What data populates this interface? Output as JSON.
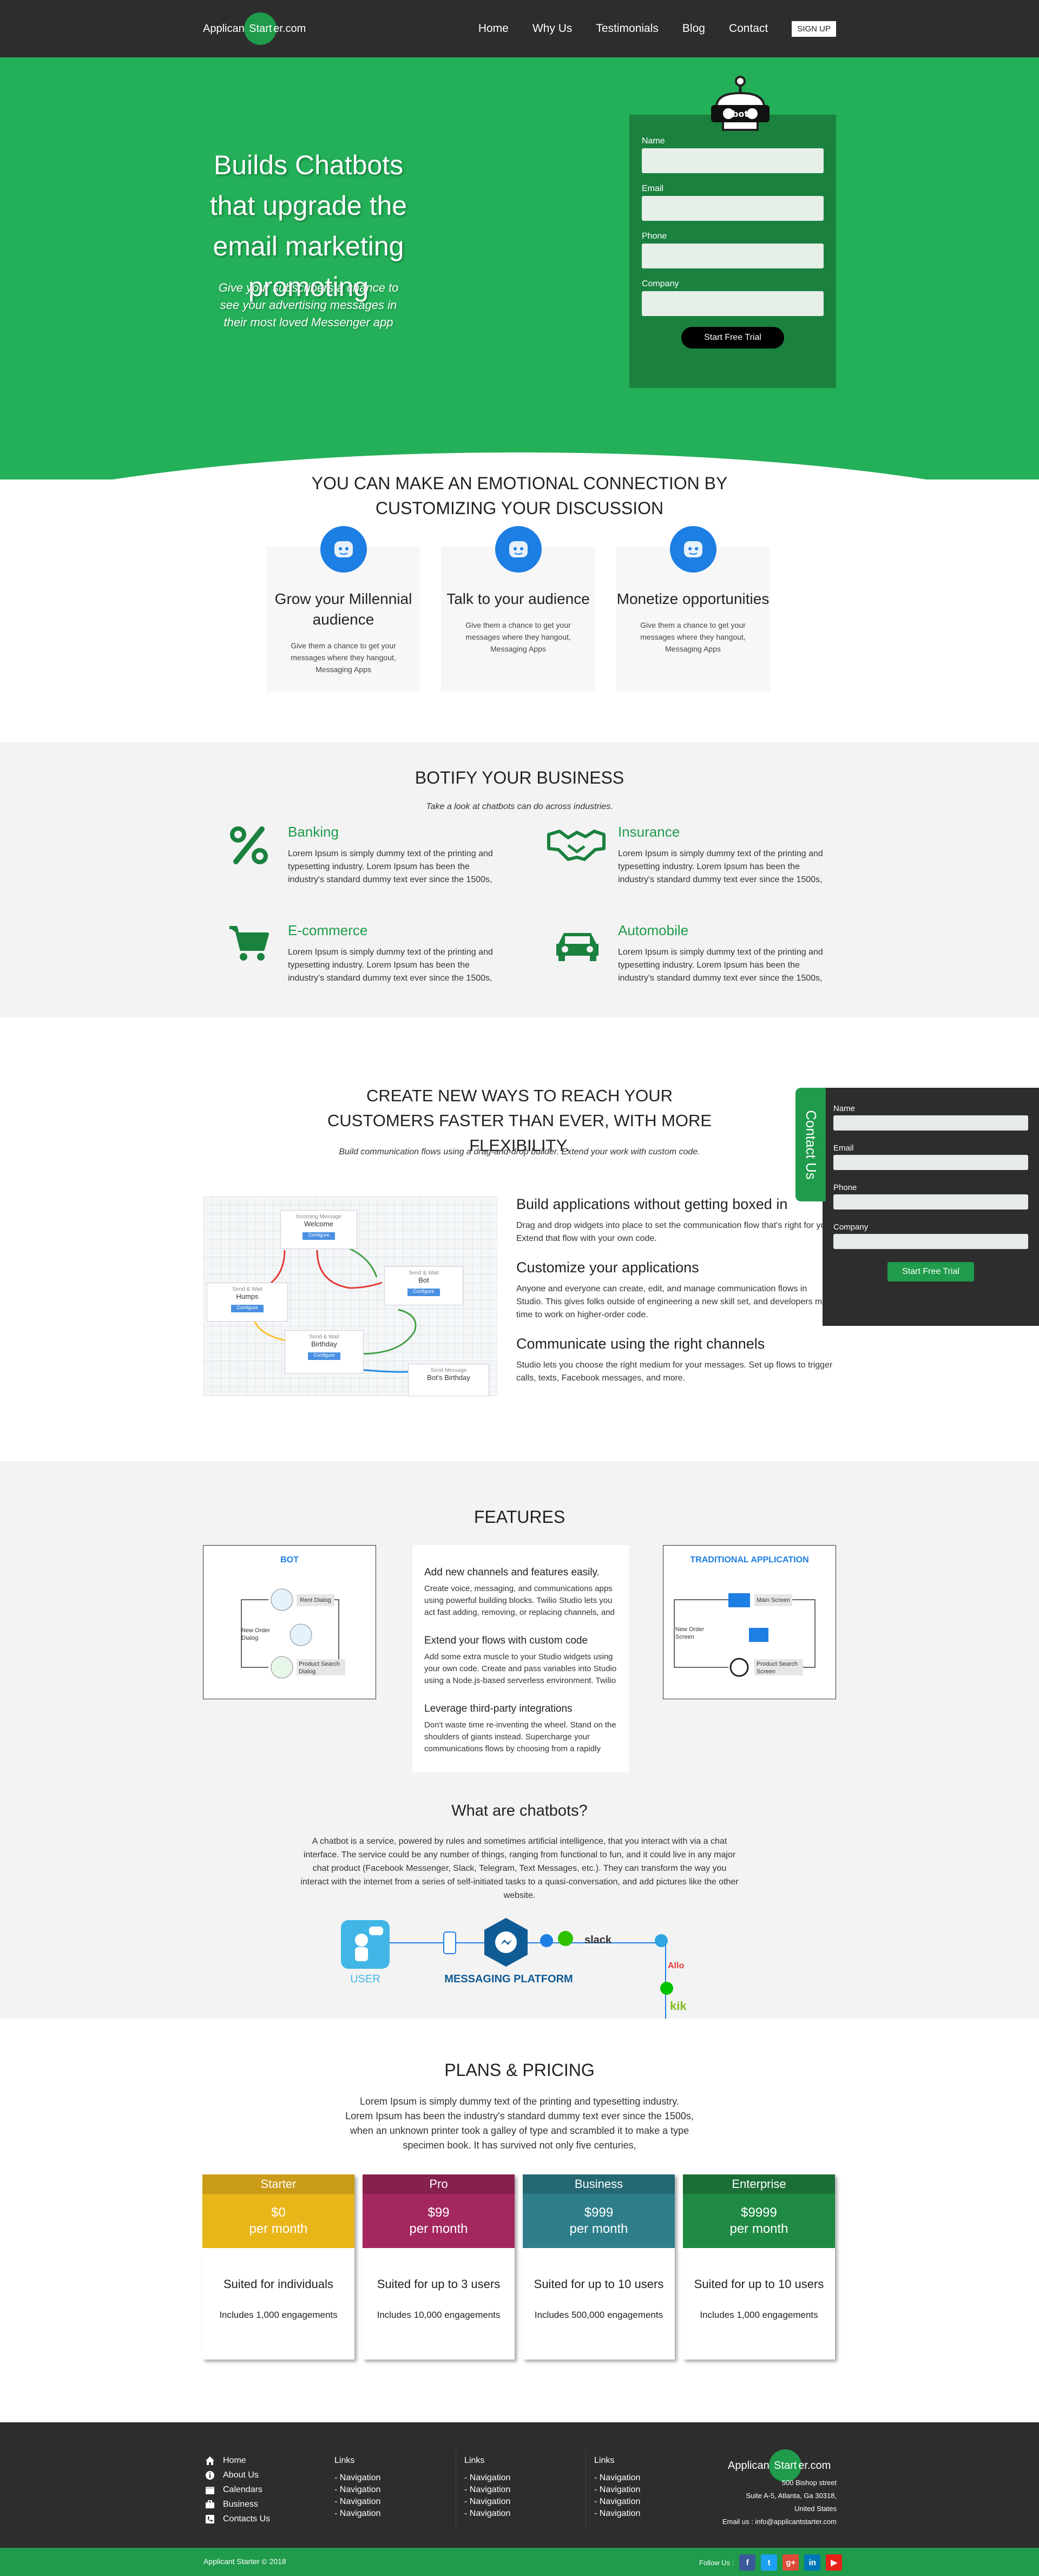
{
  "nav": {
    "logo_left": "Applicant",
    "logo_mid": "Start",
    "logo_right": "er.com",
    "items": [
      "Home",
      "Why Us",
      "Testimonials",
      "Blog",
      "Contact"
    ],
    "signup": "SIGN UP"
  },
  "hero": {
    "title": "Builds Chatbots that upgrade the email marketing promoting",
    "subtitle": "Give your subscribers a chance to see your advertising messages in their most loved Messenger app",
    "robot_text": "bot",
    "form": {
      "fields": [
        "Name",
        "Email",
        "Phone",
        "Company"
      ],
      "button": "Start Free Trial"
    }
  },
  "connect": {
    "title": "YOU CAN MAKE AN EMOTIONAL CONNECTION BY CUSTOMIZING YOUR DISCUSSION",
    "cards": [
      {
        "title": "Grow your Millennial audience",
        "text": "Give them a chance to get your messages where they hangout, Messaging Apps"
      },
      {
        "title": "Talk to your audience",
        "text": "Give them a chance to get your messages where they hangout, Messaging Apps"
      },
      {
        "title": "Monetize opportunities",
        "text": "Give them a chance to get your messages where they hangout, Messaging Apps"
      }
    ]
  },
  "botify": {
    "title": "BOTIFY YOUR BUSINESS",
    "subtitle": "Take a look at chatbots can do across industries.",
    "industries": [
      {
        "name": "Banking",
        "icon": "percent-icon",
        "text": "Lorem Ipsum is simply dummy text of the printing and typesetting industry. Lorem Ipsum has been the industry's standard dummy text ever since the 1500s,"
      },
      {
        "name": "Insurance",
        "icon": "handshake-icon",
        "text": "Lorem Ipsum is simply dummy text of the printing and typesetting industry. Lorem Ipsum has been the industry's standard dummy text ever since the 1500s,"
      },
      {
        "name": "E-commerce",
        "icon": "cart-icon",
        "text": "Lorem Ipsum is simply dummy text of the printing and typesetting industry. Lorem Ipsum has been the industry's standard dummy text ever since the 1500s,"
      },
      {
        "name": "Automobile",
        "icon": "car-icon",
        "text": "Lorem Ipsum is simply dummy text of the printing and typesetting industry. Lorem Ipsum has been the industry's standard dummy text ever since the 1500s,"
      }
    ]
  },
  "create": {
    "title": "CREATE NEW WAYS TO REACH YOUR CUSTOMERS FASTER THAN EVER, WITH MORE FLEXIBILITY.",
    "subtitle": "Build communication flows using a drag-and-drop builder. Extend your work with custom code.",
    "flow_nodes": [
      {
        "tag": "Incoming Message",
        "name": "Welcome"
      },
      {
        "tag": "Send & Wait",
        "name": "Humps"
      },
      {
        "tag": "Send & Wait",
        "name": "Bot"
      },
      {
        "tag": "Send & Wait",
        "name": "Birthday"
      },
      {
        "tag": "Send Message",
        "name": "Bot's Birthday"
      }
    ],
    "flow_button": "Configure",
    "features": [
      {
        "title": "Build applications without getting boxed in",
        "text": "Drag and drop widgets into place to set the communication flow that's right for you. Extend that flow with your own code."
      },
      {
        "title": "Customize your applications",
        "text": "Anyone and everyone can create, edit, and manage communication flows in Studio. This gives folks outside of engineering a new skill set, and developers more time to work on higher-order code."
      },
      {
        "title": "Communicate using the right channels",
        "text": "Studio lets you choose the right medium for your messages. Set up flows to trigger calls, texts, Facebook messages, and more."
      }
    ],
    "contact": {
      "tab": "Contact Us",
      "fields": [
        "Name",
        "Email",
        "Phone",
        "Company"
      ],
      "button": "Start Free Trial"
    }
  },
  "features": {
    "title": "FEATURES",
    "bot_box": {
      "label": "BOT",
      "items": [
        "Rent Dialog",
        "New Order Dialog",
        "Product Search Dialog"
      ]
    },
    "trad_box": {
      "label": "TRADITIONAL APPLICATION",
      "items": [
        "Main Screen",
        "New Order Screen",
        "Product Search Screen"
      ]
    },
    "middle": [
      {
        "title": "Add new channels and features easily.",
        "text": "Create voice, messaging, and communications apps using powerful building blocks. Twilio Studio lets you act fast adding, removing, or replacing channels, and"
      },
      {
        "title": "Extend your flows with custom code",
        "text": "Add some extra muscle to your Studio widgets using your own code. Create and pass variables into Studio using a Node.js-based serverless environment. Twilio"
      },
      {
        "title": "Leverage third-party integrations",
        "text": "Don't waste time re-inventing the wheel. Stand on the shoulders of giants instead. Supercharge your communications flows by choosing from a rapidly"
      }
    ],
    "what_title": "What are chatbots?",
    "what_text": "A chatbot is a service, powered by rules and sometimes artificial intelligence, that you interact with via a chat interface. The service could be any number of things, ranging from functional to fun, and it could live in any major chat product (Facebook Messenger, Slack, Telegram, Text Messages, etc.). They can transform the way you interact with the internet from a series of self-initiated tasks to a quasi-conversation, and add pictures like the other website.",
    "platform": {
      "user": "USER",
      "messaging": "MESSAGING PLATFORM",
      "slack": "slack",
      "allo": "Allo",
      "kik": "kik"
    }
  },
  "pricing": {
    "title": "PLANS & PRICING",
    "subtitle": "Lorem Ipsum is simply dummy text of the printing and typesetting industry. Lorem Ipsum has been the industry's standard dummy text ever since the 1500s, when an unknown printer took a galley of type and scrambled it to make a type specimen book. It has survived not only five centuries,",
    "plans": [
      {
        "name": "Starter",
        "price": "$0",
        "period": "per month",
        "suited": "Suited for individuals",
        "includes": "Includes 1,000 engagements",
        "head": "#c99b17",
        "body": "#e9b619"
      },
      {
        "name": "Pro",
        "price": "$99",
        "period": "per month",
        "suited": "Suited for up to 3 users",
        "includes": "Includes 10,000 engagements",
        "head": "#86204d",
        "body": "#a4285f"
      },
      {
        "name": "Business",
        "price": "$999",
        "period": "per month",
        "suited": "Suited for up to 10 users",
        "includes": "Includes 500,000 engagements",
        "head": "#246872",
        "body": "#2e7f8b"
      },
      {
        "name": "Enterprise",
        "price": "$9999",
        "period": "per month",
        "suited": "Suited for up to 10 users",
        "includes": "Includes 1,000 engagements",
        "head": "#1a6e36",
        "body": "#1f8a43"
      }
    ]
  },
  "footer": {
    "menu": [
      {
        "label": "Home",
        "icon": "home-icon"
      },
      {
        "label": "About Us",
        "icon": "info-icon"
      },
      {
        "label": "Calendars",
        "icon": "calendar-icon"
      },
      {
        "label": "Business",
        "icon": "briefcase-icon"
      },
      {
        "label": "Contacts Us",
        "icon": "phone-icon"
      }
    ],
    "link_cols": [
      {
        "head": "Links",
        "items": [
          "- Navigation",
          "- Navigation",
          "- Navigation",
          "- Navigation"
        ]
      },
      {
        "head": "Links",
        "items": [
          "- Navigation",
          "- Navigation",
          "- Navigation",
          "- Navigation"
        ]
      },
      {
        "head": "Links",
        "items": [
          "- Navigation",
          "- Navigation",
          "- Navigation",
          "- Navigation"
        ]
      }
    ],
    "address": [
      "500 Bishop street",
      "Suite A-5, Atlanta, Ga 30318,",
      "United States",
      "Email us : info@applicantstarter.com"
    ],
    "copyright": "Applicant Starter © 2018",
    "follow": "Follow Us :",
    "social": [
      {
        "name": "facebook-icon",
        "glyph": "f",
        "color": "#3b5998"
      },
      {
        "name": "twitter-icon",
        "glyph": "t",
        "color": "#1da1f2"
      },
      {
        "name": "google-plus-icon",
        "glyph": "g+",
        "color": "#dd4b39"
      },
      {
        "name": "linkedin-icon",
        "glyph": "in",
        "color": "#0077b5"
      },
      {
        "name": "youtube-icon",
        "glyph": "▶",
        "color": "#e62117"
      }
    ]
  },
  "colors": {
    "brand_green": "#23b058",
    "dark_green": "#1b813f",
    "dark_bg": "#2d2d2d",
    "accent_blue": "#1d7ee3"
  }
}
